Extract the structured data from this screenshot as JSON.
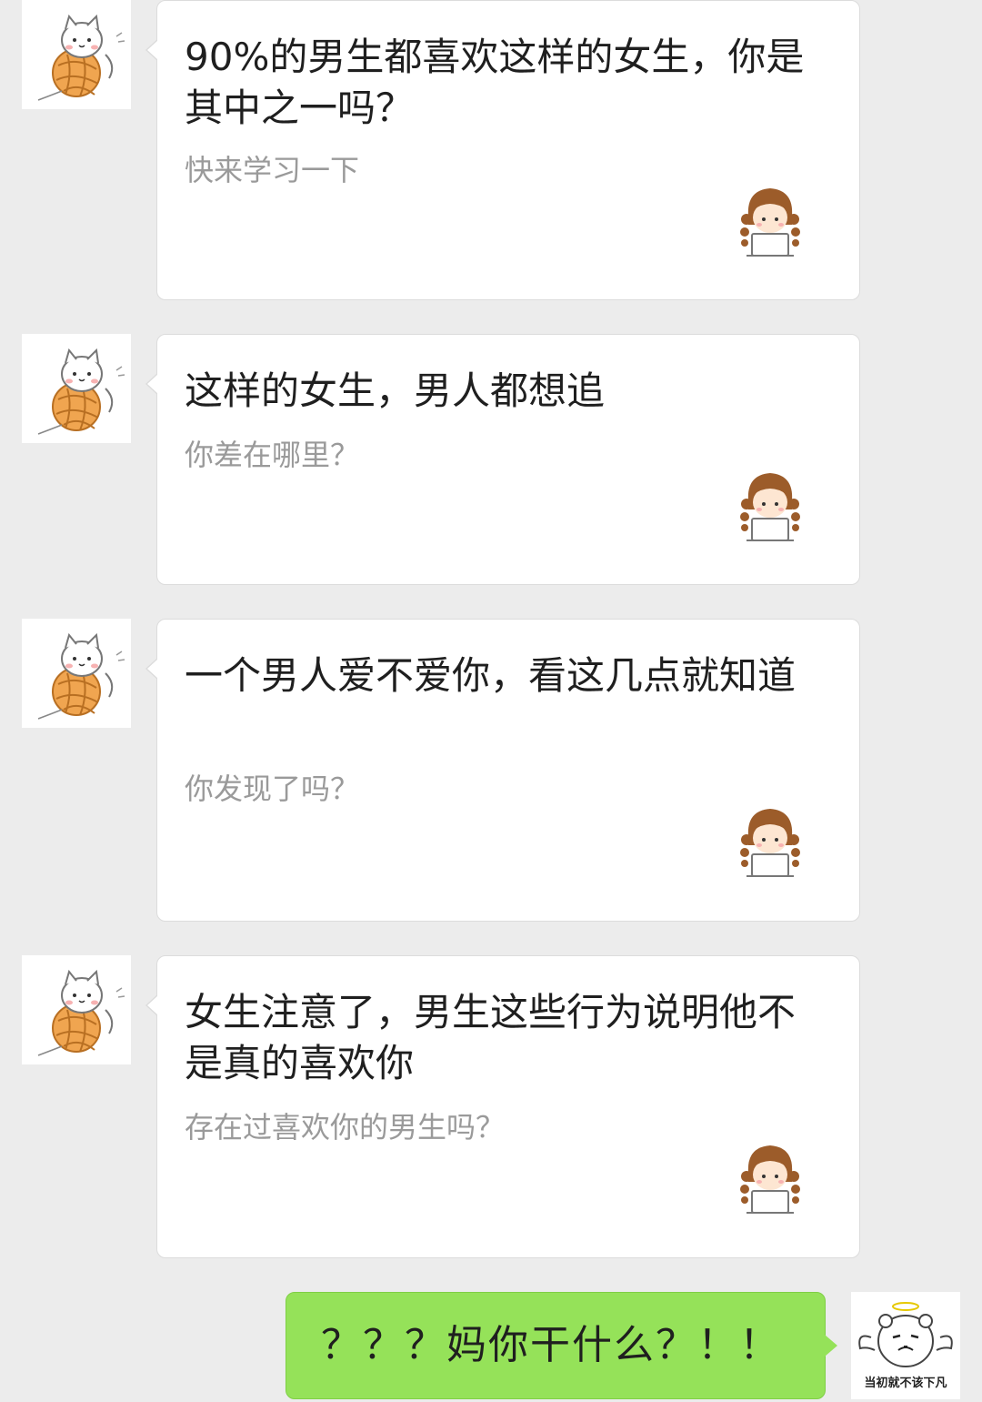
{
  "colors": {
    "background": "#ececec",
    "bubble_incoming": "#ffffff",
    "bubble_outgoing": "#95e259",
    "title_text": "#1f1f1f",
    "subtitle_text": "#9a9a9a"
  },
  "messages": [
    {
      "sender_avatar_icon": "cat-on-yarn-ball-icon",
      "title": "90%的男生都喜欢这样的女生，你是其中之一吗？",
      "subtitle": "快来学习一下",
      "thumbnail_icon": "girl-with-laptop-icon"
    },
    {
      "sender_avatar_icon": "cat-on-yarn-ball-icon",
      "title": "这样的女生，男人都想追",
      "subtitle": "你差在哪里？",
      "thumbnail_icon": "girl-with-laptop-icon"
    },
    {
      "sender_avatar_icon": "cat-on-yarn-ball-icon",
      "title": "一个男人爱不爱你，看这几点就知道",
      "subtitle": "你发现了吗？",
      "thumbnail_icon": "girl-with-laptop-icon"
    },
    {
      "sender_avatar_icon": "cat-on-yarn-ball-icon",
      "title": "女生注意了，男生这些行为说明他不是真的喜欢你",
      "subtitle": "存在过喜欢你的男生吗？",
      "thumbnail_icon": "girl-with-laptop-icon"
    }
  ],
  "reply": {
    "text": "？？？妈你干什么？！！",
    "avatar_icon": "angel-bear-sticker-icon",
    "avatar_caption": "当初就不该下凡"
  }
}
